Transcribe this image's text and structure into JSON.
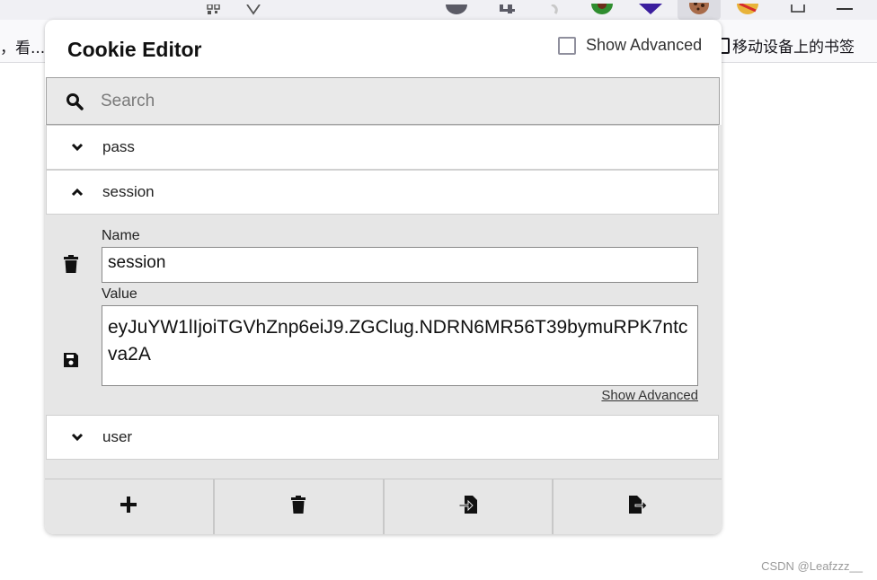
{
  "browser": {
    "bookmark_left_text": "，看...",
    "bookmark_right_label": "移动设备上的书签"
  },
  "popup": {
    "title": "Cookie Editor",
    "show_advanced_label": "Show Advanced",
    "search_placeholder": "Search",
    "cookies": [
      {
        "name": "pass",
        "expanded": false
      },
      {
        "name": "session",
        "expanded": true
      },
      {
        "name": "user",
        "expanded": false
      }
    ],
    "detail": {
      "name_label": "Name",
      "name_value": "session",
      "value_label": "Value",
      "value_value": "eyJuYW1lIjoiTGVhZnp6eiJ9.ZGClug.NDRN6MR56T39bymuRPK7ntcva2A",
      "show_advanced_link": "Show Advanced"
    },
    "bottom_buttons": [
      {
        "icon": "plus-icon"
      },
      {
        "icon": "trash-icon"
      },
      {
        "icon": "import-icon"
      },
      {
        "icon": "export-icon"
      }
    ]
  },
  "watermark": "CSDN @Leafzzz__",
  "colors": {
    "popup_bg": "#ffffff",
    "list_bg": "#e6e6e6",
    "search_bg": "#e9e9e9"
  }
}
